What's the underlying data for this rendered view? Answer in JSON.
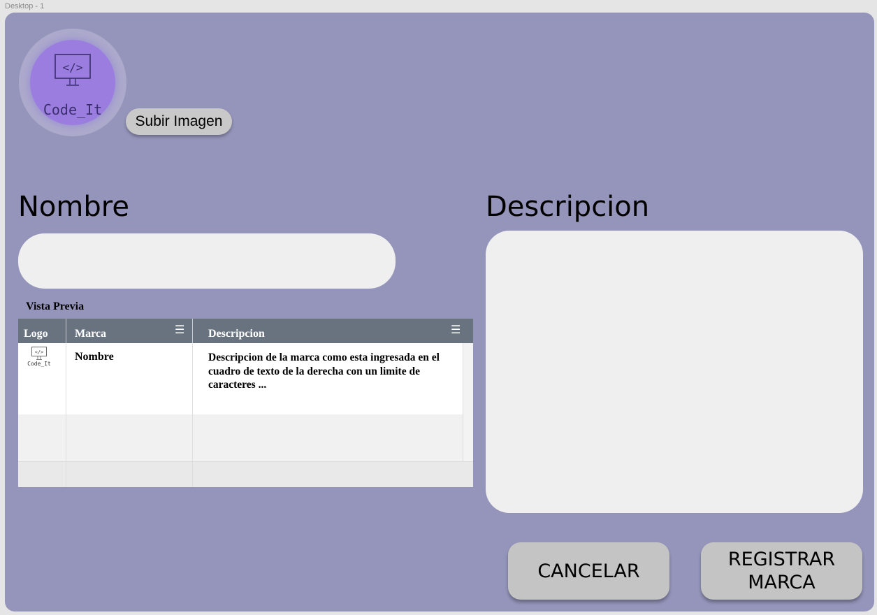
{
  "frame": {
    "label": "Desktop - 1"
  },
  "logo": {
    "text": "Code_It",
    "icon": "monitor-code-icon"
  },
  "upload": {
    "label": "Subir Imagen"
  },
  "name_section": {
    "heading": "Nombre",
    "value": "",
    "placeholder": ""
  },
  "description_section": {
    "heading": "Descripcion",
    "value": "",
    "placeholder": ""
  },
  "preview": {
    "label": "Vista Previa",
    "columns": [
      "Logo",
      "Marca",
      "Descripcion"
    ],
    "rows": [
      {
        "logo_text": "Code_It",
        "marca": "Nombre",
        "descripcion": "Descripcion de la marca como esta ingresada en el cuadro de texto de la derecha con un limite de caracteres ..."
      }
    ]
  },
  "actions": {
    "cancel": "CANCELAR",
    "register": "REGISTRAR MARCA"
  },
  "colors": {
    "background": "#9595bb",
    "input": "#efefef",
    "button": "#c4c4c4",
    "grid_header": "#68737f",
    "logo_fill": "#9b7ddf"
  }
}
